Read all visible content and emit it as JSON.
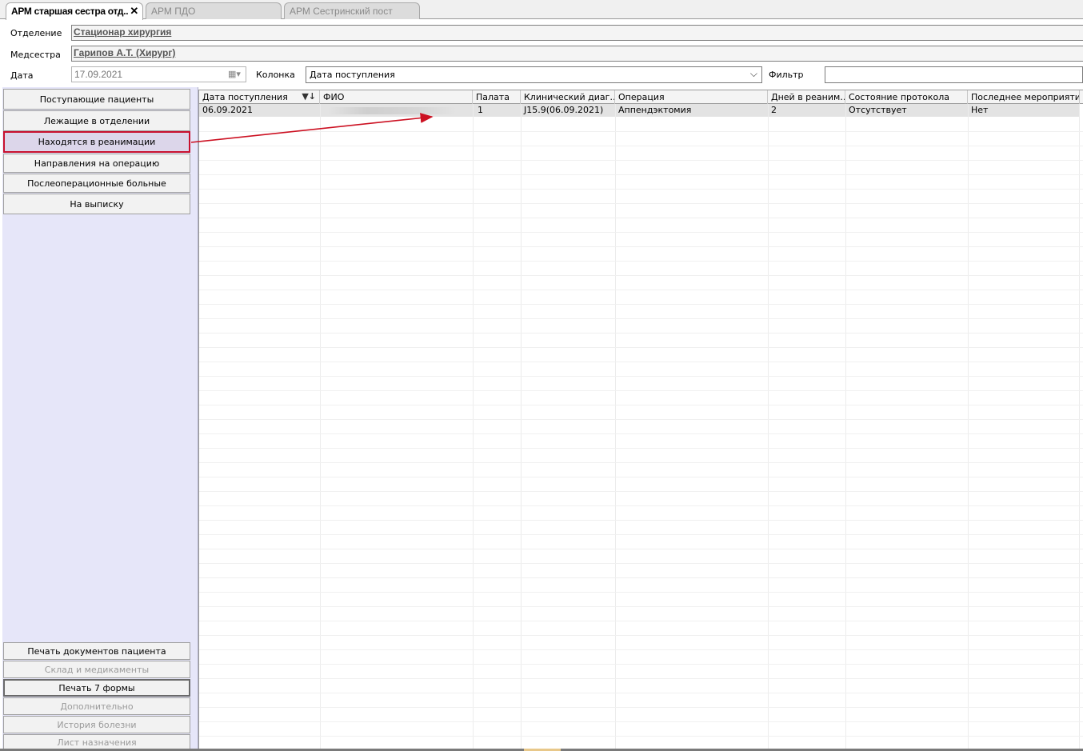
{
  "tabs": [
    {
      "label": "АРМ старшая сестра отд..",
      "active": true,
      "close": "✕"
    },
    {
      "label": "АРМ ПДО",
      "active": false
    },
    {
      "label": "АРМ Сестринский пост",
      "active": false
    }
  ],
  "form": {
    "department_label": "Отделение",
    "department_value": "Стационар  хирургия",
    "nurse_label": "Медсестра",
    "nurse_value": "Гарипов А.Т. (Хирург)",
    "date_label": "Дата",
    "date_value": "17.09.2021",
    "column_label": "Колонка",
    "column_value": "Дата поступления",
    "filter_label": "Фильтр",
    "filter_value": ""
  },
  "nav": {
    "top": [
      {
        "label": "Поступающие пациенты"
      },
      {
        "label": "Лежащие в отделении"
      },
      {
        "label": "Находятся в реанимации",
        "selected": true
      },
      {
        "label": "Направления на операцию"
      },
      {
        "label": "Послеоперационные больные"
      },
      {
        "label": "На выписку"
      }
    ],
    "bottom": [
      {
        "label": "Печать документов пациента"
      },
      {
        "label": "Склад и медикаменты",
        "disabled": true
      },
      {
        "label": "Печать 7 формы"
      },
      {
        "label": "Дополнительно",
        "disabled": true
      },
      {
        "label": "История болезни",
        "disabled": true
      },
      {
        "label": "Лист назначения",
        "disabled": true
      }
    ]
  },
  "grid": {
    "columns": [
      "Дата поступления",
      "ФИО",
      "Палата",
      "Клинический диаг…",
      "Операция",
      "Дней в реаним…",
      "Состояние протокола",
      "Последнее мероприятие"
    ],
    "rows": [
      [
        "06.09.2021",
        "",
        "1",
        "J15.9(06.09.2021)",
        "Аппендэктомия",
        "2",
        "Отсутствует",
        "Нет"
      ]
    ]
  },
  "colors": {
    "highlight_border": "#c8102e",
    "panel_bg": "#e6e6f9",
    "annotation_arrow": "#cc1122"
  }
}
